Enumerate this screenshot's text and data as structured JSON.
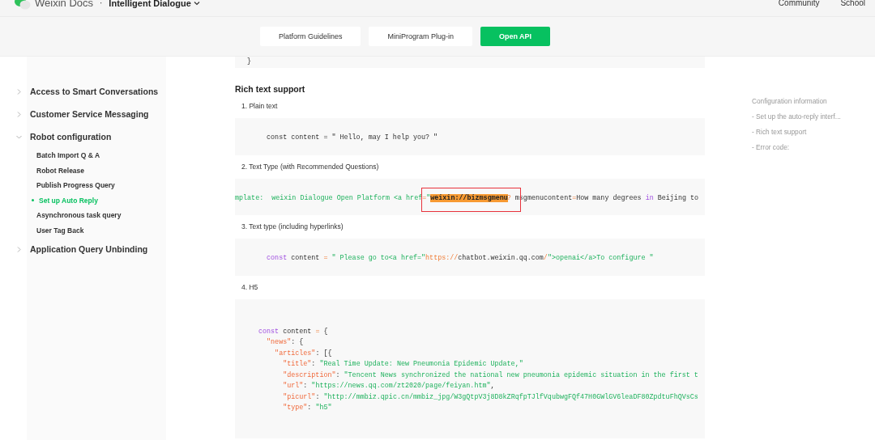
{
  "header": {
    "brand": "Weixin Docs",
    "separator": "·",
    "product": "Intelligent Dialogue",
    "links": [
      "Community",
      "School"
    ]
  },
  "tabs": [
    {
      "label": "Platform Guidelines",
      "selected": false
    },
    {
      "label": "MiniProgram Plug-in",
      "selected": false
    },
    {
      "label": "Open API",
      "selected": true
    }
  ],
  "sidebar": {
    "items": [
      {
        "label": "Access to Smart Conversations",
        "expanded": false
      },
      {
        "label": "Customer Service Messaging",
        "expanded": false
      },
      {
        "label": "Robot configuration",
        "expanded": true,
        "children": [
          {
            "label": "Batch Import Q & A",
            "selected": false
          },
          {
            "label": "Robot Release",
            "selected": false
          },
          {
            "label": "Publish Progress Query",
            "selected": false
          },
          {
            "label": "Set up Auto Reply",
            "selected": true
          },
          {
            "label": "Asynchronous task query",
            "selected": false
          },
          {
            "label": "User Tag Back",
            "selected": false
          }
        ]
      },
      {
        "label": "Application Query Unbinding",
        "expanded": false
      }
    ]
  },
  "content": {
    "top_block": {
      "clipped_left": true,
      "lines": [
        [
          {
            "kind": "plain",
            "t": "   }"
          }
        ]
      ]
    },
    "heading": "Rich text support",
    "sections": [
      {
        "label": "1. Plain text",
        "block": {
          "clipped_left": false,
          "lines": [
            [
              {
                "kind": "plain",
                "t": "  const content = \" Hello, may I help you? \""
              }
            ]
          ]
        }
      },
      {
        "label": "2. Text Type (with Recommended Questions)",
        "block": {
          "clipped_left": true,
          "lines": [
            [
              {
                "kind": "string",
                "t": "mplate:  weixin Dialogue Open Platform <a href"
              },
              {
                "kind": "op",
                "t": "="
              },
              {
                "kind": "string",
                "t": "\""
              },
              {
                "kind": "highlight",
                "t": "weixin://bizmsgmenu"
              },
              {
                "kind": "op",
                "t": "?"
              },
              {
                "kind": "plain",
                "t": " msgmenucontent"
              },
              {
                "kind": "op",
                "t": "="
              },
              {
                "kind": "plain",
                "t": "How many degrees "
              },
              {
                "kind": "keyword",
                "t": "in"
              },
              {
                "kind": "plain",
                "t": " Beijing to"
              }
            ]
          ]
        }
      },
      {
        "label": "3. Text type (including hyperlinks)",
        "block": {
          "clipped_left": false,
          "lines": [
            [
              {
                "kind": "keyword",
                "t": "  const"
              },
              {
                "kind": "plain",
                "t": " content "
              },
              {
                "kind": "op",
                "t": "="
              },
              {
                "kind": "string",
                "t": " \" Please go to<a href=\""
              },
              {
                "kind": "op",
                "t": "https://"
              },
              {
                "kind": "plain",
                "t": "chatbot.weixin.qq.com"
              },
              {
                "kind": "op",
                "t": "/"
              },
              {
                "kind": "string",
                "t": "\">openai</a>To configure \""
              }
            ]
          ]
        }
      },
      {
        "label": "4. H5",
        "block": {
          "clipped_left": false,
          "lines": [
            [
              {
                "kind": "keyword",
                "t": "const"
              },
              {
                "kind": "plain",
                "t": " content "
              },
              {
                "kind": "op",
                "t": "="
              },
              {
                "kind": "plain",
                "t": " {"
              }
            ],
            [
              {
                "kind": "key",
                "t": "  \"news\""
              },
              {
                "kind": "plain",
                "t": ": {"
              }
            ],
            [
              {
                "kind": "key",
                "t": "    \"articles\""
              },
              {
                "kind": "plain",
                "t": ": [{"
              }
            ],
            [
              {
                "kind": "key",
                "t": "      \"title\""
              },
              {
                "kind": "plain",
                "t": ": "
              },
              {
                "kind": "string",
                "t": "\"Real Time Update: New Pneumonia Epidemic Update,\""
              }
            ],
            [
              {
                "kind": "key",
                "t": "      \"description\""
              },
              {
                "kind": "plain",
                "t": ": "
              },
              {
                "kind": "string",
                "t": "\"Tencent News synchronized the national new pneumonia epidemic situation in the first t"
              }
            ],
            [
              {
                "kind": "key",
                "t": "      \"url\""
              },
              {
                "kind": "plain",
                "t": ": "
              },
              {
                "kind": "string",
                "t": "\"https://news.qq.com/zt2020/page/feiyan.htm\""
              },
              {
                "kind": "plain",
                "t": ","
              }
            ],
            [
              {
                "kind": "key",
                "t": "      \"picurl\""
              },
              {
                "kind": "plain",
                "t": ": "
              },
              {
                "kind": "string",
                "t": "\"http://mmbiz.qpic.cn/mmbiz_jpg/W3gQtpV3j8D8kZRqfpTJlfVqubwgFQf47H0GWlGV6leaDF80ZpdtuFhQVsCs"
              }
            ],
            [
              {
                "kind": "key",
                "t": "      \"type\""
              },
              {
                "kind": "plain",
                "t": ": "
              },
              {
                "kind": "string",
                "t": "\"h5\""
              }
            ]
          ]
        }
      }
    ]
  },
  "toc": {
    "title": "Configuration information",
    "items": [
      "- Set up the auto-reply interf...",
      "- Rich text support",
      "- Error code:"
    ]
  }
}
